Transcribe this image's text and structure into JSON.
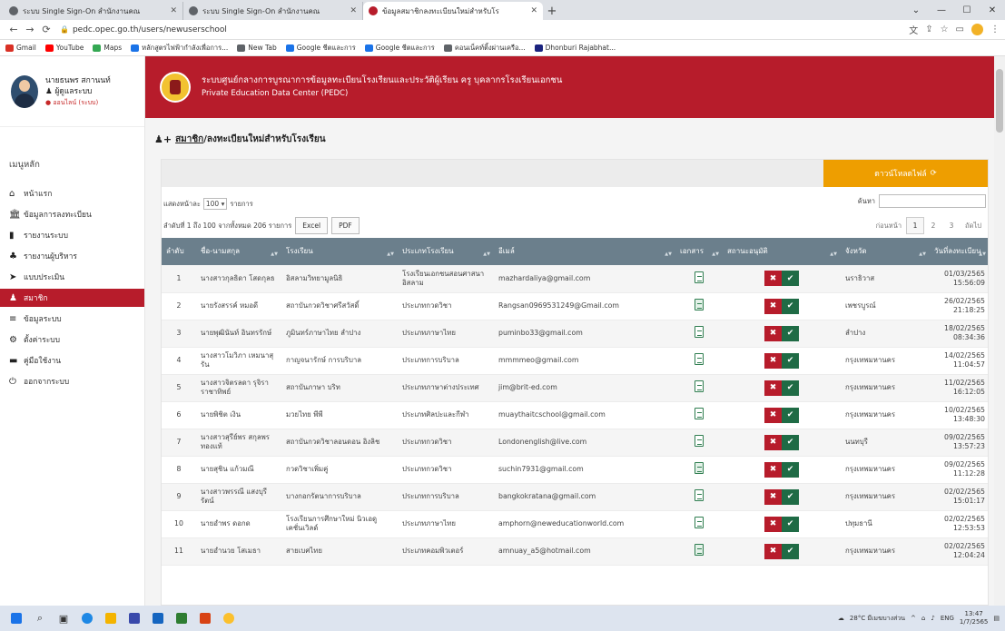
{
  "browser": {
    "tabs": [
      {
        "label": "ระบบ Single Sign-On สำนักงานคณ",
        "active": false
      },
      {
        "label": "ระบบ Single Sign-On สำนักงานคณ",
        "active": false
      },
      {
        "label": "ข้อมูลสมาชิกลงทะเบียนใหม่สำหรับโร",
        "active": true
      }
    ],
    "url": "pedc.opec.go.th/users/newuserschool",
    "bookmarks": [
      {
        "label": "Gmail",
        "color": "#d93025"
      },
      {
        "label": "YouTube",
        "color": "#ff0000"
      },
      {
        "label": "Maps",
        "color": "#34a853"
      },
      {
        "label": "หลักสูตรไฟฟ้ากำลังเพื่อการ...",
        "color": "#1a73e8"
      },
      {
        "label": "New Tab",
        "color": "#5f6368"
      },
      {
        "label": "Google ชีตและการ",
        "color": "#1a73e8"
      },
      {
        "label": "Google ชีตและการ",
        "color": "#1a73e8"
      },
      {
        "label": "คอนเน็คท์ติ้งผ่านเครือ...",
        "color": "#5f6368"
      },
      {
        "label": "Dhonburi Rajabhat...",
        "color": "#1a237e"
      }
    ]
  },
  "sidebar": {
    "user_name": "นายธนพร สกานนท์",
    "user_role": "ผู้ดูแลระบบ",
    "user_status": "ออนไลน์ (ระบบ)",
    "menu_title": "เมนูหลัก",
    "items": [
      {
        "label": "หน้าแรก",
        "icon": "home-icon",
        "glyph": "⌂",
        "active": false
      },
      {
        "label": "ข้อมูลการลงทะเบียน",
        "icon": "bank-icon",
        "glyph": "🏛",
        "active": false
      },
      {
        "label": "รายงานระบบ",
        "icon": "bar-chart-icon",
        "glyph": "▮",
        "active": false
      },
      {
        "label": "รายงานผู้บริหาร",
        "icon": "users-icon",
        "glyph": "♣",
        "active": false
      },
      {
        "label": "แบบประเมิน",
        "icon": "send-icon",
        "glyph": "➤",
        "active": false
      },
      {
        "label": "สมาชิก",
        "icon": "members-icon",
        "glyph": "♟",
        "active": true
      },
      {
        "label": "ข้อมูลระบบ",
        "icon": "list-icon",
        "glyph": "≡",
        "active": false
      },
      {
        "label": "ตั้งค่าระบบ",
        "icon": "gear-icon",
        "glyph": "⚙",
        "active": false
      },
      {
        "label": "คู่มือใช้งาน",
        "icon": "book-icon",
        "glyph": "▬",
        "active": false
      },
      {
        "label": "ออกจากระบบ",
        "icon": "power-icon",
        "glyph": "⏻",
        "active": false
      }
    ]
  },
  "banner": {
    "title": "ระบบศูนย์กลางการบูรณาการข้อมูลทะเบียนโรงเรียนและประวัติผู้เรียน ครู บุคลากรโรงเรียนเอกชน",
    "subtitle": "Private Education Data Center (PEDC)"
  },
  "breadcrumb": {
    "link": "สมาชิก",
    "separator": " / ",
    "current": "ลงทะเบียนใหม่สำหรับโรงเรียน"
  },
  "toolbar": {
    "download_label": "ดาวน์โหลดไฟล์",
    "download_icon": "⟳",
    "show_prefix": "แสดงหน้าละ",
    "page_size": "100",
    "show_suffix": "รายการ",
    "info": "ลำดับที่ 1 ถึง 100 จากทั้งหมด 206 รายการ",
    "excel_label": "Excel",
    "pdf_label": "PDF",
    "search_label": "ค้นหา",
    "search_value": "",
    "pager_prev": "ก่อนหน้า",
    "pager_pages": [
      "1",
      "2",
      "3"
    ],
    "pager_next": "ถัดไป"
  },
  "table": {
    "headers": [
      "ลำดับ",
      "ชื่อ-นามสกุล",
      "โรงเรียน",
      "ประเภทโรงเรียน",
      "อีเมล์",
      "เอกสาร",
      "สถานะอนุมัติ",
      "จังหวัด",
      "วันที่ลงทะเบียน"
    ],
    "rows": [
      {
        "no": "1",
        "name": "นางสาวกุลธิดา โสดกุลธ",
        "school": "อิสลามวิทยามูลนิธิ",
        "type": "โรงเรียนเอกชนสอนศาสนาอิสลาม",
        "email": "mazhardaliya@gmail.com",
        "doc": "pdf",
        "province": "นราธิวาส",
        "date": "01/03/2565",
        "time": "15:56:09"
      },
      {
        "no": "2",
        "name": "นายรังสรรค์ หมอดี",
        "school": "สถาบันกวดวิชาศรีสวัสดิ์",
        "type": "ประเภทกวดวิชา",
        "email": "Rangsan0969531249@Gmail.com",
        "doc": "img",
        "province": "เพชรบูรณ์",
        "date": "26/02/2565",
        "time": "21:18:25"
      },
      {
        "no": "3",
        "name": "นายพุฒินันท์ อินทรรักษ์",
        "school": "ภูมินทร์ภาษาไทย ลำปาง",
        "type": "ประเภทภาษาไทย",
        "email": "puminbo33@gmail.com",
        "doc": "pdf",
        "province": "ลำปาง",
        "date": "18/02/2565",
        "time": "08:34:36"
      },
      {
        "no": "4",
        "name": "นางสาวโมวิภา เหมนาสุรัน",
        "school": "กาญจนารักษ์ การบริบาล",
        "type": "ประเภทการบริบาล",
        "email": "mmmmeo@gmail.com",
        "doc": "pdf",
        "province": "กรุงเทพมหานคร",
        "date": "14/02/2565",
        "time": "11:04:57"
      },
      {
        "no": "5",
        "name": "นางสาวจิตรลดา รุจิรา ราชาทิพย์",
        "school": "สถาบันภาษา บริท",
        "type": "ประเภทภาษาต่างประเทศ",
        "email": "jim@brit-ed.com",
        "doc": "pdf",
        "province": "กรุงเทพมหานคร",
        "date": "11/02/2565",
        "time": "16:12:05"
      },
      {
        "no": "6",
        "name": "นายพิชิต เงิน",
        "school": "มวยไทย พีพี",
        "type": "ประเภทศิลปะและกีฬา",
        "email": "muaythaitcschool@gmail.com",
        "doc": "pdf",
        "province": "กรุงเทพมหานคร",
        "date": "10/02/2565",
        "time": "13:48:30"
      },
      {
        "no": "7",
        "name": "นางสาวสุรีย์พร สกุลพร ทองแท้",
        "school": "สถาบันกวดวิชาลอนดอน อิงลิช",
        "type": "ประเภทกวดวิชา",
        "email": "Londonenglish@live.com",
        "doc": "pdf",
        "province": "นนทบุรี",
        "date": "09/02/2565",
        "time": "13:57:23"
      },
      {
        "no": "8",
        "name": "นายสุชิน แก้วมณี",
        "school": "กวดวิชาเพิ่มคู่",
        "type": "ประเภทกวดวิชา",
        "email": "suchin7931@gmail.com",
        "doc": "img",
        "province": "กรุงเทพมหานคร",
        "date": "09/02/2565",
        "time": "11:12:28"
      },
      {
        "no": "9",
        "name": "นางสาวพรรณี แสงบุรีรัตน์",
        "school": "บางกอกรัตนาการบริบาล",
        "type": "ประเภทการบริบาล",
        "email": "bangkokratana@gmail.com",
        "doc": "pdf",
        "province": "กรุงเทพมหานคร",
        "date": "02/02/2565",
        "time": "15:01:17"
      },
      {
        "no": "10",
        "name": "นายอำพร ดอกด",
        "school": "โรงเรียนการศึกษาใหม่ นิวเอดูเคชั่นเวิลด์",
        "type": "ประเภทภาษาไทย",
        "email": "amphorn@neweducationworld.com",
        "doc": "pdf",
        "province": "ปทุมธานี",
        "date": "02/02/2565",
        "time": "12:53:53"
      },
      {
        "no": "11",
        "name": "นายอำนวย โสเมธา",
        "school": "สายเบศไทย",
        "type": "ประเภทคอมพิวเตอร์",
        "email": "amnuay_a5@hotmail.com",
        "doc": "img",
        "province": "กรุงเทพมหานคร",
        "date": "02/02/2565",
        "time": "12:04:24"
      }
    ]
  },
  "taskbar": {
    "weather": "28°C มีเมฆบางส่วน",
    "lang": "ENG",
    "time": "13:47",
    "date": "1/7/2565"
  }
}
